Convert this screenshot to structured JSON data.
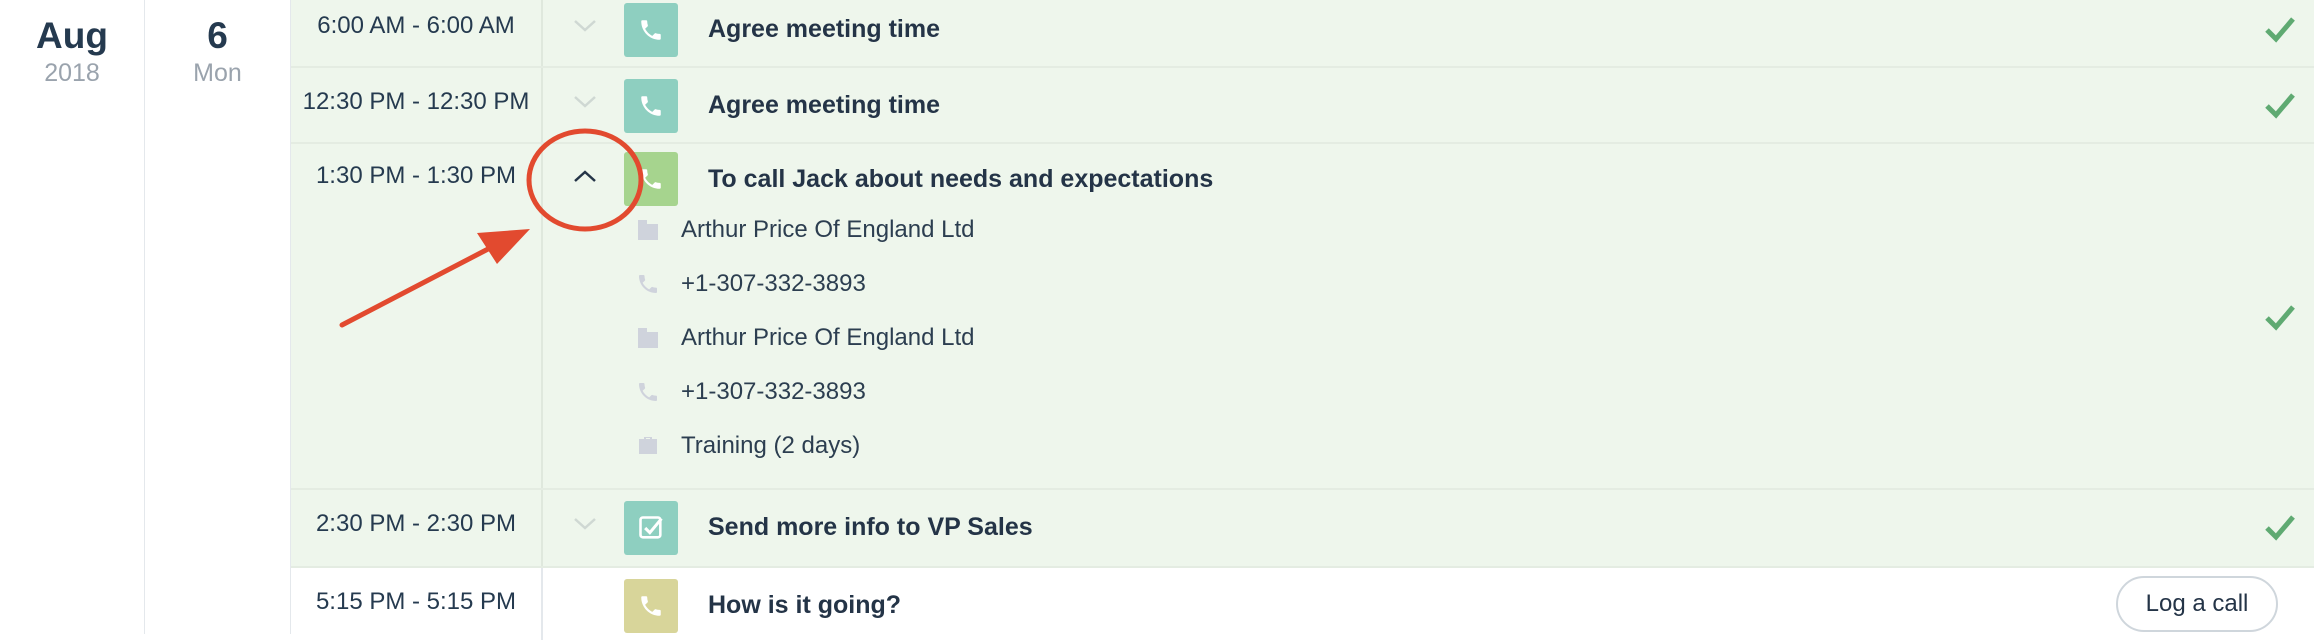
{
  "date": {
    "month": "Aug",
    "year": "2018",
    "day": "6",
    "weekday": "Mon"
  },
  "colors": {
    "done_bg": "#eef6ec",
    "check": "#5faa72",
    "call_done": "#8ecfc0",
    "call_open": "#d8d59a",
    "task_done": "#8ecfc0",
    "highlight": "#e24a2f"
  },
  "activities": [
    {
      "time": "6:00 AM - 6:00 AM",
      "title": "Agree meeting time",
      "icon": "phone-icon",
      "status": "completed"
    },
    {
      "time": "12:30 PM - 12:30 PM",
      "title": "Agree meeting time",
      "icon": "phone-icon",
      "status": "completed"
    },
    {
      "time": "1:30 PM - 1:30 PM",
      "title": "To call Jack about needs and expectations",
      "icon": "phone-icon",
      "status": "completed",
      "expanded": true,
      "details": [
        {
          "icon": "building-icon",
          "text": "Arthur Price Of England Ltd"
        },
        {
          "icon": "phone-icon",
          "text": "+1-307-332-3893"
        },
        {
          "icon": "building-icon",
          "text": "Arthur Price Of England Ltd"
        },
        {
          "icon": "phone-icon",
          "text": "+1-307-332-3893"
        },
        {
          "icon": "briefcase-icon",
          "text": "Training (2 days)"
        }
      ]
    },
    {
      "time": "2:30 PM - 2:30 PM",
      "title": "Send more info to VP Sales",
      "icon": "task-check-icon",
      "status": "completed"
    },
    {
      "time": "5:15 PM - 5:15 PM",
      "title": "How is it going?",
      "icon": "phone-icon",
      "status": "open",
      "action_label": "Log a call"
    }
  ]
}
